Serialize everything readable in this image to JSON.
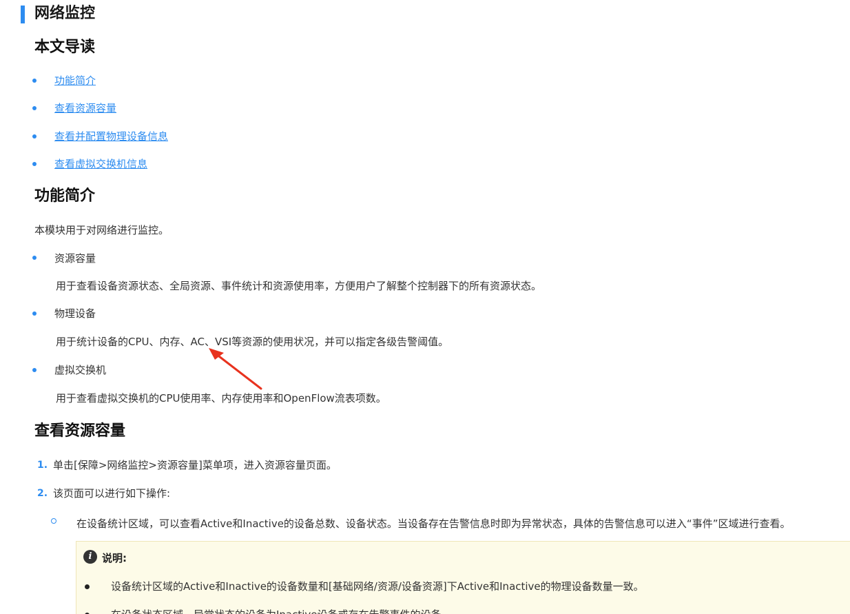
{
  "page": {
    "title": "网络监控"
  },
  "toc": {
    "heading": "本文导读",
    "links": [
      "功能简介",
      "查看资源容量",
      "查看并配置物理设备信息",
      "查看虚拟交换机信息"
    ]
  },
  "features": {
    "heading": "功能简介",
    "intro": "本模块用于对网络进行监控。",
    "items": [
      {
        "title": "资源容量",
        "desc": "用于查看设备资源状态、全局资源、事件统计和资源使用率，方便用户了解整个控制器下的所有资源状态。"
      },
      {
        "title": "物理设备",
        "desc": "用于统计设备的CPU、内存、AC、VSI等资源的使用状况，并可以指定各级告警阈值。"
      },
      {
        "title": "虚拟交换机",
        "desc": "用于查看虚拟交换机的CPU使用率、内存使用率和OpenFlow流表项数。"
      }
    ]
  },
  "capacity": {
    "heading": "查看资源容量",
    "steps": [
      {
        "num": "1.",
        "text": "单击[保障>网络监控>资源容量]菜单项，进入资源容量页面。"
      },
      {
        "num": "2.",
        "text": "该页面可以进行如下操作:"
      }
    ],
    "sub_item": "在设备统计区域，可以查看Active和Inactive的设备总数、设备状态。当设备存在告警信息时即为异常状态，具体的告警信息可以进入“事件”区域进行查看。",
    "note": {
      "icon": "info-icon",
      "title": "说明:",
      "items": [
        "设备统计区域的Active和Inactive的设备数量和[基础网络/资源/设备资源]下Active和Inactive的物理设备数量一致。",
        "在设备状态区域，异常状态的设备为Inactive设备或存在告警事件的设备。"
      ]
    }
  },
  "colors": {
    "accent": "#2d8cf0",
    "annotation_arrow": "#e8321e",
    "note_bg": "#fdfbe8"
  }
}
